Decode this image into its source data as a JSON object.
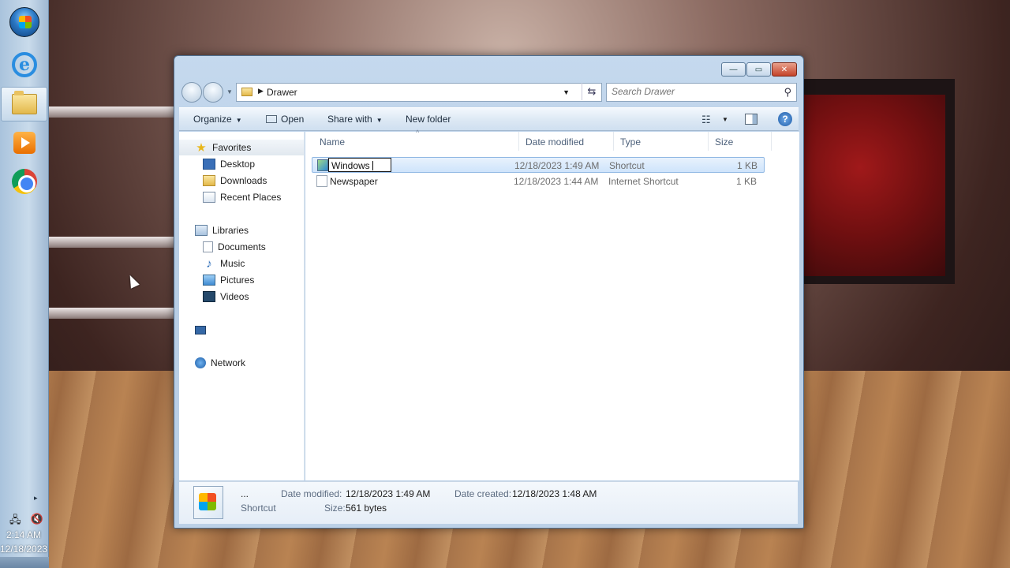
{
  "taskbar": {
    "apps": [
      {
        "name": "start",
        "icon": "windows-orb-icon"
      },
      {
        "name": "internet-explorer",
        "icon": "internet-explorer-icon"
      },
      {
        "name": "windows-explorer",
        "icon": "folder-icon",
        "active": true
      },
      {
        "name": "media-player",
        "icon": "media-player-icon"
      },
      {
        "name": "chrome",
        "icon": "chrome-icon"
      }
    ],
    "tray_arrow": "▸",
    "time": "2:14 AM",
    "date": "12/18/2023"
  },
  "window": {
    "controls": {
      "minimize": "—",
      "maximize": "▭",
      "close": "✕"
    },
    "address": {
      "path_item": "Drawer",
      "separator": "▶",
      "dropdown": "▼"
    },
    "refresh_glyph": "⇆",
    "search": {
      "placeholder": "Search Drawer",
      "value": ""
    },
    "toolbar": {
      "organize": "Organize",
      "open": "Open",
      "share_with": "Share with",
      "new_folder": "New folder",
      "dropdown_glyph": "▼"
    },
    "nav_pane": {
      "favorites": {
        "label": "Favorites",
        "items": [
          "Desktop",
          "Downloads",
          "Recent Places"
        ]
      },
      "libraries": {
        "label": "Libraries",
        "items": [
          "Documents",
          "Music",
          "Pictures",
          "Videos"
        ]
      },
      "computer": {
        "label": ""
      },
      "network": {
        "label": "Network"
      }
    },
    "columns": {
      "name": "Name",
      "date_modified": "Date modified",
      "type": "Type",
      "size": "Size",
      "sort_glyph": "^"
    },
    "files": [
      {
        "name": "Windows",
        "date_modified": "12/18/2023 1:49 AM",
        "type": "Shortcut",
        "size": "1 KB",
        "selected": true,
        "renaming": true
      },
      {
        "name": "Newspaper",
        "date_modified": "12/18/2023 1:44 AM",
        "type": "Internet Shortcut",
        "size": "1 KB",
        "selected": false
      }
    ],
    "details": {
      "name": "...",
      "type": "Shortcut",
      "date_modified_label": "Date modified:",
      "date_modified_value": "12/18/2023 1:49 AM",
      "date_created_label": "Date created:",
      "date_created_value": "12/18/2023 1:48 AM",
      "size_label": "Size:",
      "size_value": "561 bytes"
    }
  },
  "colors": {
    "window_frame": "#b7cde4",
    "selection": "#cfe4fb",
    "taskbar": "#c9dbeb"
  }
}
